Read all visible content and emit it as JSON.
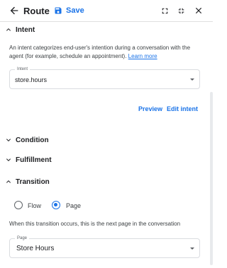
{
  "toolbar": {
    "title": "Route",
    "save_label": "Save"
  },
  "sections": {
    "intent": "Intent",
    "condition": "Condition",
    "fulfillment": "Fulfillment",
    "transition": "Transition"
  },
  "intent": {
    "description": "An intent categorizes end-user's intention during a conversation with the agent (for example, schedule an appointment).",
    "learn_more": "Learn more",
    "field_label": "Intent",
    "value": "store.hours",
    "preview_label": "Preview",
    "edit_label": "Edit intent"
  },
  "transition": {
    "options": [
      "Flow",
      "Page"
    ],
    "selected": "Page",
    "description": "When this transition occurs, this is the next page in the conversation",
    "page_field_label": "Page",
    "page_value": "Store Hours"
  },
  "colors": {
    "accent": "#1a73e8",
    "text": "#202124",
    "border": "#dadce0"
  }
}
